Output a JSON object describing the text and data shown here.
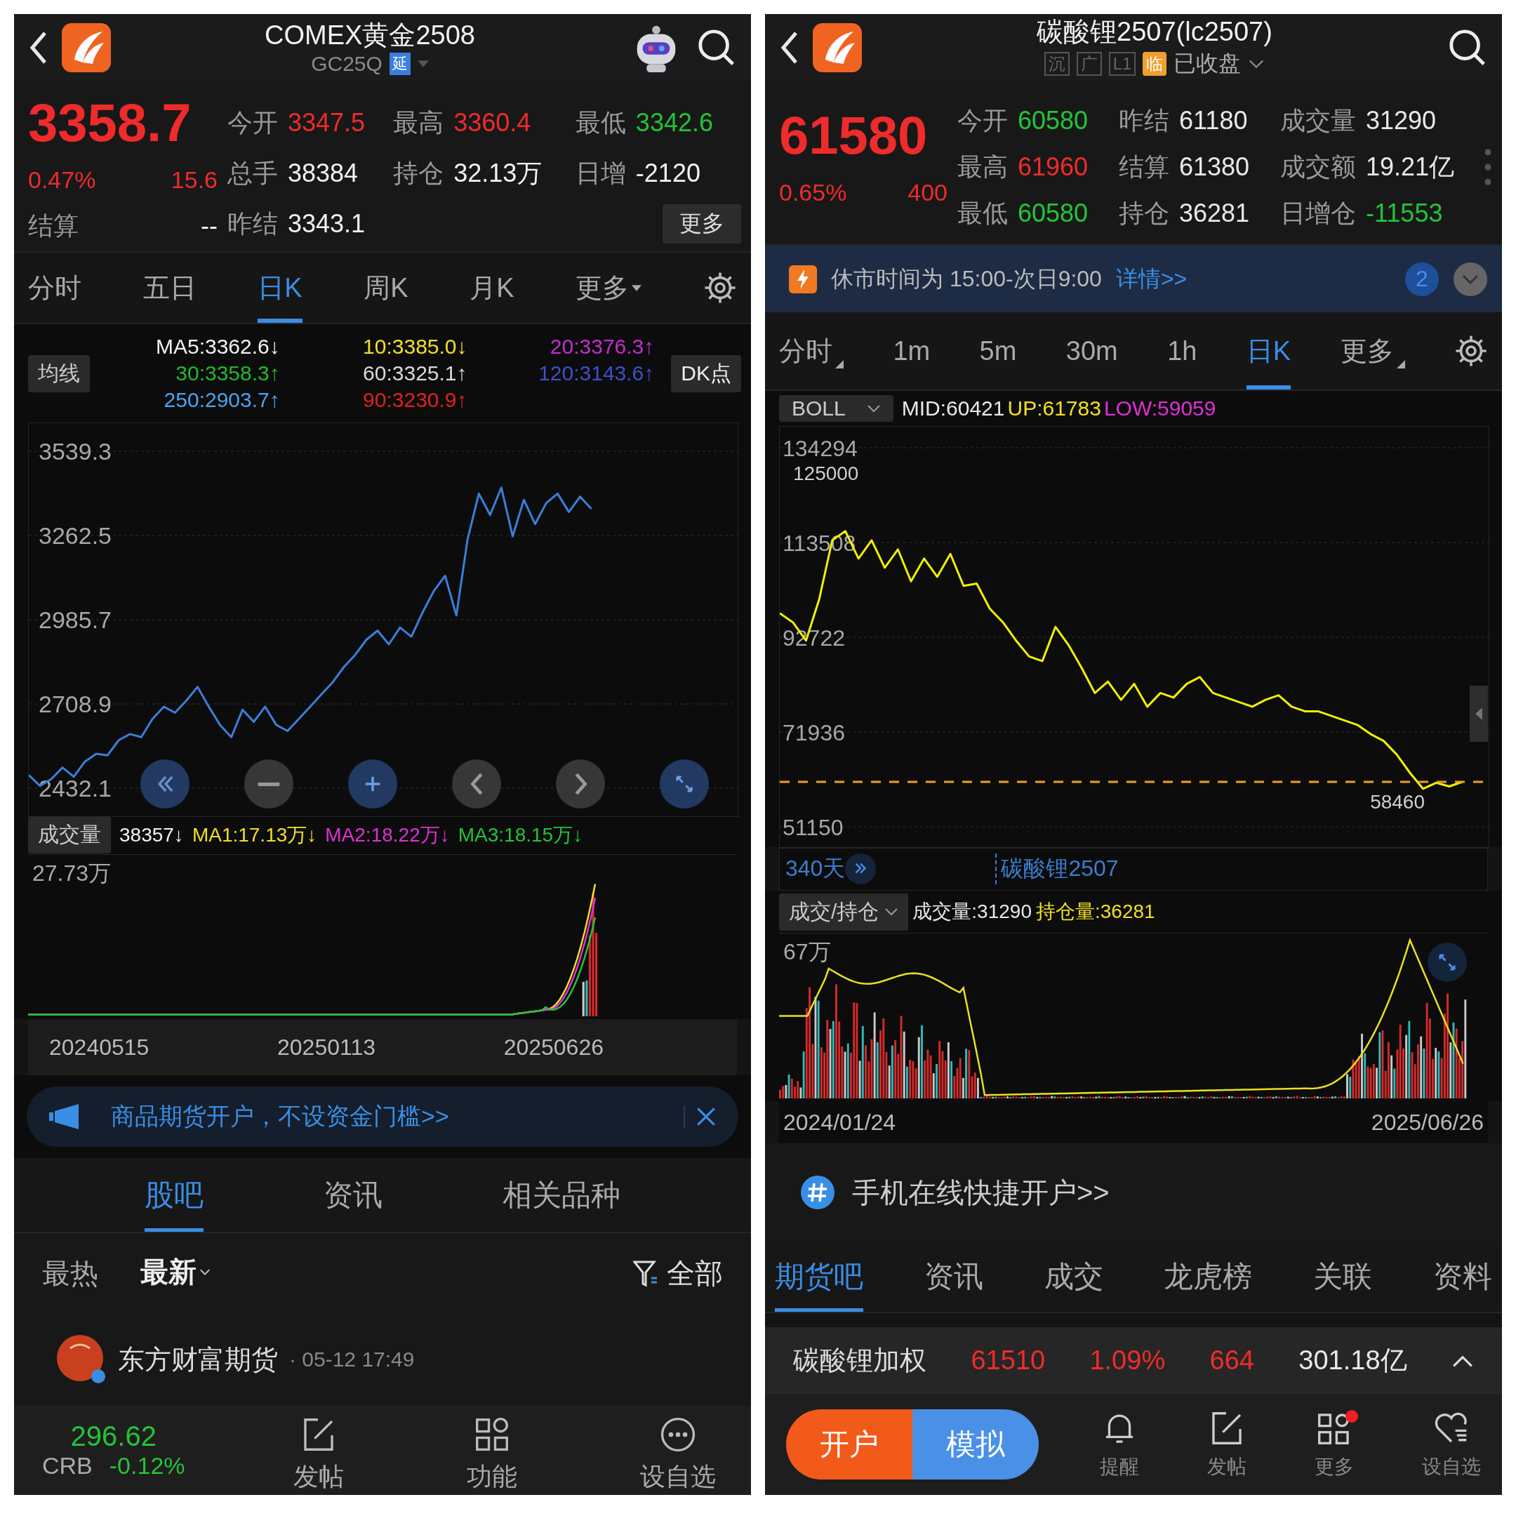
{
  "left": {
    "header": {
      "title": "COMEX黄金2508",
      "code": "GC25Q",
      "badge": "延"
    },
    "quote": {
      "price": "3358.7",
      "change_pct": "0.47%",
      "change": "15.6",
      "settle": {
        "label": "结算",
        "value": "--"
      },
      "stats": [
        {
          "label": "今开",
          "value": "3347.5",
          "color": "#ef2b2b"
        },
        {
          "label": "最高",
          "value": "3360.4",
          "color": "#ef2b2b"
        },
        {
          "label": "最低",
          "value": "3342.6",
          "color": "#22c438"
        },
        {
          "label": "总手",
          "value": "38384",
          "color": "#f2f2f2"
        },
        {
          "label": "持仓",
          "value": "32.13万",
          "color": "#f2f2f2"
        },
        {
          "label": "日增",
          "value": "-2120",
          "color": "#f2f2f2"
        },
        {
          "label": "昨结",
          "value": "3343.1",
          "color": "#f2f2f2"
        }
      ],
      "more_button": "更多"
    },
    "period_tabs": [
      {
        "label": "分时",
        "selected": false,
        "has_menu": false
      },
      {
        "label": "五日",
        "selected": false,
        "has_menu": false
      },
      {
        "label": "日K",
        "selected": true,
        "has_menu": false
      },
      {
        "label": "周K",
        "selected": false,
        "has_menu": false
      },
      {
        "label": "月K",
        "selected": false,
        "has_menu": false
      },
      {
        "label": "更多",
        "selected": false,
        "has_menu": true
      }
    ],
    "ma_legend": {
      "selector": "均线",
      "dk_button": "DK点",
      "items": [
        {
          "text": "MA5:3362.6↓",
          "color": "#f2f2f2"
        },
        {
          "text": "10:3385.0↓",
          "color": "#f0e020"
        },
        {
          "text": "20:3376.3↑",
          "color": "#c22ed0"
        },
        {
          "text": "30:3358.3↑",
          "color": "#22b82a"
        },
        {
          "text": "60:3325.1↑",
          "color": "#d8d8d8"
        },
        {
          "text": "120:3143.6↑",
          "color": "#3f50c8"
        },
        {
          "text": "250:2903.7↑",
          "color": "#4aa2f0"
        },
        {
          "text": "90:3230.9↑",
          "color": "#e02020"
        }
      ]
    },
    "price_chart": {
      "chart_data": {
        "type": "line",
        "ylim": [
          2432.1,
          3539.3
        ],
        "grid": true,
        "yticks": [
          2432.1,
          2708.9,
          2985.7,
          3262.5,
          3539.3
        ],
        "series": [
          {
            "color": "#3b7fd9",
            "values": [
              2475,
              2440,
              2462,
              2500,
              2470,
              2520,
              2545,
              2540,
              2590,
              2610,
              2600,
              2660,
              2700,
              2680,
              2720,
              2765,
              2700,
              2640,
              2600,
              2690,
              2650,
              2700,
              2640,
              2620,
              2660,
              2700,
              2740,
              2780,
              2830,
              2870,
              2920,
              2950,
              2905,
              2960,
              2930,
              3010,
              3080,
              3130,
              3000,
              3250,
              3400,
              3330,
              3420,
              3260,
              3380,
              3300,
              3370,
              3400,
              3340,
              3390,
              3350,
              null,
              null,
              null,
              null,
              null,
              null,
              null,
              null,
              null,
              null,
              null,
              null,
              null
            ]
          }
        ]
      }
    },
    "volume": {
      "selector": "成交量",
      "max_label": "27.73万",
      "items": [
        {
          "text": "38357↓",
          "color": "#f2f2f2"
        },
        {
          "text": "MA1:17.13万↓",
          "color": "#f0e020"
        },
        {
          "text": "MA2:18.22万↓",
          "color": "#e030d8"
        },
        {
          "text": "MA3:18.15万↓",
          "color": "#22c438"
        }
      ]
    },
    "axis_dates": [
      "20240515",
      "20250113",
      "20250626"
    ],
    "banner": {
      "text": "商品期货开户，不设资金门槛>>"
    },
    "content_tabs": [
      {
        "label": "股吧",
        "selected": true
      },
      {
        "label": "资讯",
        "selected": false
      },
      {
        "label": "相关品种",
        "selected": false
      }
    ],
    "sort": [
      {
        "label": "最热",
        "selected": false
      },
      {
        "label": "最新",
        "selected": true
      }
    ],
    "filter": "全部",
    "post": {
      "author": "东方财富期货",
      "time": "· 05-12 17:49"
    },
    "bottom_bar": {
      "index": {
        "value": "296.62",
        "name": "CRB",
        "change": "-0.12%"
      },
      "actions": [
        {
          "label": "发帖",
          "kind": "edit"
        },
        {
          "label": "功能",
          "kind": "grid"
        },
        {
          "label": "设自选",
          "kind": "more"
        }
      ]
    }
  },
  "right": {
    "header": {
      "title": "碳酸锂2507(lc2507)",
      "tags": [
        "沉",
        "广",
        "L1"
      ],
      "badge": "临",
      "status": "已收盘"
    },
    "quote": {
      "price": "61580",
      "change_pct": "0.65%",
      "change": "400",
      "stats": [
        {
          "label": "今开",
          "value": "60580",
          "color": "#22c438"
        },
        {
          "label": "昨结",
          "value": "61180",
          "color": "#e8e8e8"
        },
        {
          "label": "成交量",
          "value": "31290",
          "color": "#e8e8e8"
        },
        {
          "label": "最高",
          "value": "61960",
          "color": "#ef2b2b"
        },
        {
          "label": "结算",
          "value": "61380",
          "color": "#e8e8e8"
        },
        {
          "label": "成交额",
          "value": "19.21亿",
          "color": "#e8e8e8"
        },
        {
          "label": "最低",
          "value": "60580",
          "color": "#22c438"
        },
        {
          "label": "持仓",
          "value": "36281",
          "color": "#e8e8e8"
        },
        {
          "label": "日增仓",
          "value": "-11553",
          "color": "#22c438"
        }
      ]
    },
    "notice": {
      "text": "休市时间为 15:00-次日9:00",
      "link": "详情>>",
      "count": "2"
    },
    "period_tabs": [
      {
        "label": "分时",
        "selected": false,
        "has_menu": true
      },
      {
        "label": "1m",
        "selected": false,
        "has_menu": false
      },
      {
        "label": "5m",
        "selected": false,
        "has_menu": false
      },
      {
        "label": "30m",
        "selected": false,
        "has_menu": false
      },
      {
        "label": "1h",
        "selected": false,
        "has_menu": false
      },
      {
        "label": "日K",
        "selected": true,
        "has_menu": false
      },
      {
        "label": "更多",
        "selected": false,
        "has_menu": true
      }
    ],
    "indicator": {
      "selector": "BOLL",
      "items": [
        {
          "text": "MID:60421",
          "color": "#e8e8e8"
        },
        {
          "text": "UP:61783",
          "color": "#f0e020"
        },
        {
          "text": "LOW:59059",
          "color": "#e030d8"
        }
      ]
    },
    "price_chart": {
      "high_label": "125000",
      "low_label": "58460",
      "chart_data": {
        "type": "line",
        "ylim": [
          51150,
          134294
        ],
        "grid": true,
        "yticks": [
          51150,
          71936,
          92722,
          113508,
          134294
        ],
        "series": [
          {
            "color": "#f2f000",
            "values": [
              98000,
              96000,
              92000,
              101000,
              114000,
              116000,
              110000,
              114000,
              108000,
              112000,
              105000,
              110000,
              106000,
              111000,
              104000,
              104500,
              99000,
              96000,
              92000,
              88500,
              87500,
              95000,
              91000,
              86000,
              80500,
              83000,
              79000,
              82500,
              77500,
              80500,
              79500,
              82500,
              84000,
              80500,
              79500,
              78500,
              77500,
              79000,
              80000,
              77500,
              76500,
              76500,
              75500,
              74500,
              73500,
              71500,
              70000,
              67000,
              63000,
              59500,
              60800,
              60000,
              61000,
              null,
              null
            ]
          },
          {
            "color": "#f0a020",
            "line_style": "dashed",
            "values": [
              61000,
              61000,
              61000,
              61000,
              61000,
              61000,
              61000,
              61000,
              61000,
              61000,
              61000,
              61000,
              61000,
              61000,
              61000,
              61000,
              61000,
              61000,
              61000,
              61000,
              61000,
              61000,
              61000,
              61000,
              61000,
              61000,
              61000,
              61000,
              61000,
              61000,
              61000,
              61000,
              61000,
              61000,
              61000,
              61000,
              61000,
              61000,
              61000,
              61000,
              61000,
              61000,
              61000,
              61000,
              61000,
              61000,
              61000,
              61000,
              61000,
              61000,
              61000,
              61000,
              61000,
              61000,
              61000
            ]
          }
        ]
      }
    },
    "strip": {
      "days": "340天",
      "contract": "碳酸锂2507"
    },
    "volume": {
      "selector": "成交/持仓",
      "max_label": "67万",
      "items": [
        {
          "text": "成交量:31290",
          "color": "#e8e8e8"
        },
        {
          "text": "持仓量:36281",
          "color": "#f0e020"
        }
      ]
    },
    "axis_dates": [
      "2024/01/24",
      "2025/06/26"
    ],
    "open_account": "手机在线快捷开户>>",
    "content_tabs": [
      {
        "label": "期货吧",
        "selected": true
      },
      {
        "label": "资讯",
        "selected": false
      },
      {
        "label": "成交",
        "selected": false
      },
      {
        "label": "龙虎榜",
        "selected": false
      },
      {
        "label": "关联",
        "selected": false
      },
      {
        "label": "资料",
        "selected": false
      }
    ],
    "summary": {
      "name": "碳酸锂加权",
      "values": [
        {
          "text": "61510",
          "color": "#ef2b2b"
        },
        {
          "text": "1.09%",
          "color": "#ef2b2b"
        },
        {
          "text": "664",
          "color": "#ef2b2b"
        },
        {
          "text": "301.18亿",
          "color": "#e8e8e8"
        }
      ]
    },
    "bottom_bar": {
      "open_button": "开户",
      "demo_button": "模拟",
      "actions": [
        {
          "label": "提醒",
          "kind": "bell",
          "has_badge": false
        },
        {
          "label": "发帖",
          "kind": "edit",
          "has_badge": false
        },
        {
          "label": "更多",
          "kind": "grid",
          "has_badge": true
        },
        {
          "label": "设自选",
          "kind": "heart",
          "has_badge": false
        }
      ]
    }
  }
}
